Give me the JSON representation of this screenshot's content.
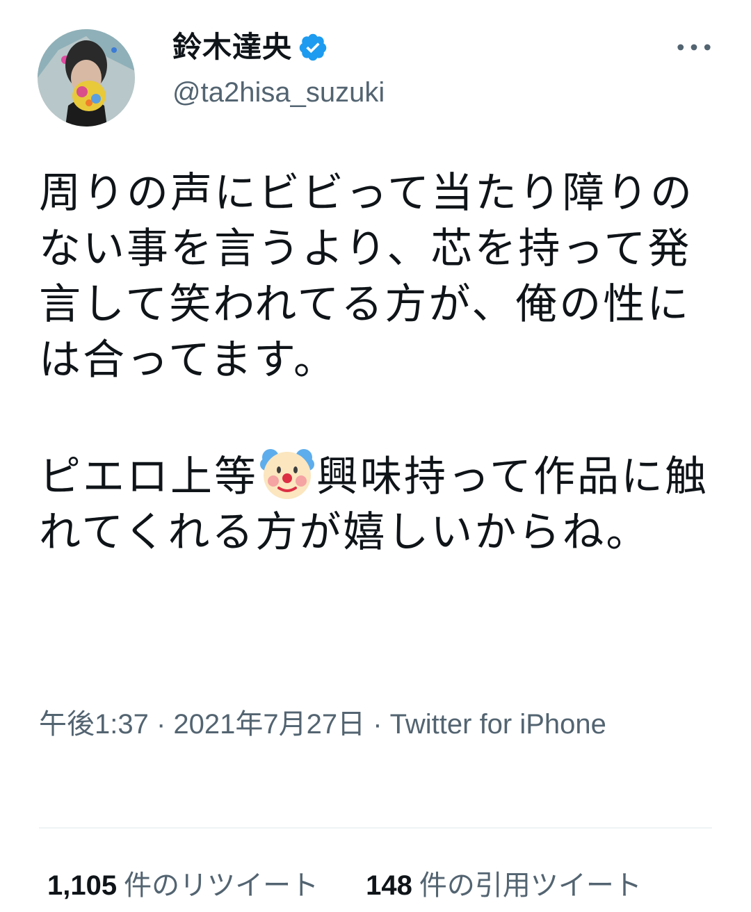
{
  "user": {
    "display_name": "鈴木達央",
    "handle": "@ta2hisa_suzuki",
    "verified": true
  },
  "tweet": {
    "paragraphs": [
      "周りの声にビビって当たり障りのない事を言うより、芯を持って発言して笑われてる方が、俺の性には合ってます。",
      "ピエロ上等",
      "興味持って作品に触れてくれる方が嬉しいからね。"
    ],
    "emoji": "clown-face-icon"
  },
  "meta": {
    "timestamp": "午後1:37 · 2021年7月27日 · Twitter for iPhone"
  },
  "stats": {
    "retweets_count": "1,105",
    "retweets_label": "件のリツイート",
    "quotes_count": "148",
    "quotes_label": "件の引用ツイート"
  },
  "colors": {
    "text": "#0f1419",
    "secondary": "#536471",
    "verified": "#1d9bf0",
    "divider": "#eff3f4"
  },
  "icons": {
    "more": "more-dots-icon",
    "verified": "verified-badge-icon"
  }
}
